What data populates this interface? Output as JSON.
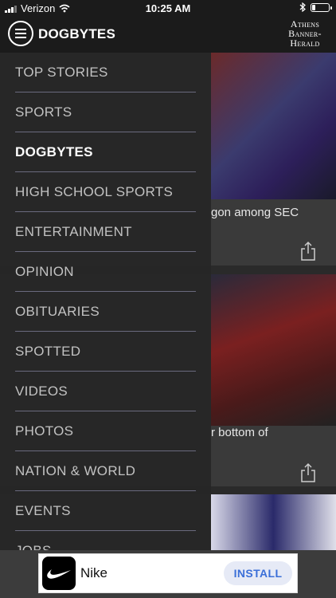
{
  "status_bar": {
    "carrier": "Verizon",
    "time": "10:25 AM",
    "battery_level": 0.2
  },
  "header": {
    "title": "DOGBYTES",
    "brand": {
      "line1": "Athens",
      "line2": "Banner-",
      "line3": "Herald"
    }
  },
  "drawer": {
    "items": [
      {
        "label": "TOP STORIES",
        "active": false
      },
      {
        "label": "SPORTS",
        "active": false
      },
      {
        "label": "DOGBYTES",
        "active": true
      },
      {
        "label": "HIGH SCHOOL SPORTS",
        "active": false
      },
      {
        "label": "ENTERTAINMENT",
        "active": false
      },
      {
        "label": "OPINION",
        "active": false
      },
      {
        "label": "OBITUARIES",
        "active": false
      },
      {
        "label": "SPOTTED",
        "active": false
      },
      {
        "label": "VIDEOS",
        "active": false
      },
      {
        "label": "PHOTOS",
        "active": false
      },
      {
        "label": "NATION & WORLD",
        "active": false
      },
      {
        "label": "EVENTS",
        "active": false
      },
      {
        "label": "JOBS",
        "active": false
      }
    ]
  },
  "articles": [
    {
      "title_visible": "gon among SEC"
    },
    {
      "title_visible": "r bottom of"
    }
  ],
  "ad": {
    "name": "Nike",
    "cta": "INSTALL"
  },
  "colors": {
    "background": "#111111",
    "drawer": "#262626",
    "divider": "#6a6a7e",
    "install_text": "#3b6fd8"
  }
}
